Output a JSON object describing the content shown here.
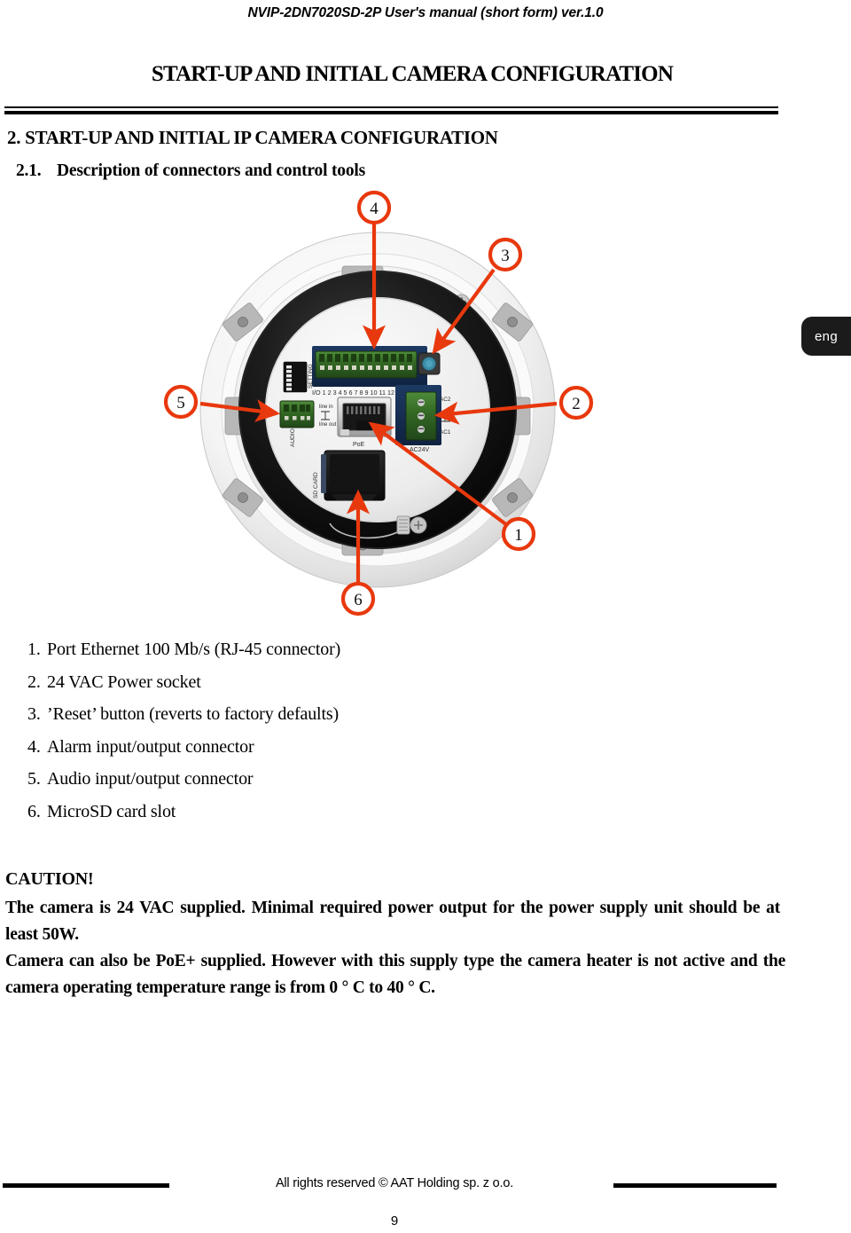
{
  "running_head": "NVIP-2DN7020SD-2P User's manual (short form) ver.1.0",
  "chapter_title": "START-UP AND INITIAL CAMERA CONFIGURATION",
  "headings": {
    "h2": "2. START-UP AND INITIAL IP CAMERA CONFIGURATION",
    "h3_number": "2.1.",
    "h3_text": "Description of connectors and control tools"
  },
  "language_tab": {
    "label": "eng"
  },
  "figure": {
    "alt": "Rear view of dome IP camera housing showing connector board with numbered callouts",
    "callouts": [
      {
        "id": "1",
        "label": "1"
      },
      {
        "id": "2",
        "label": "2"
      },
      {
        "id": "3",
        "label": "3"
      },
      {
        "id": "4",
        "label": "4"
      },
      {
        "id": "5",
        "label": "5"
      },
      {
        "id": "6",
        "label": "6"
      }
    ],
    "board_labels": {
      "setting": "SETTING",
      "io_pins": "I/O 1 2 3 4 5 6 7 8 9 10 11 12",
      "line_in": "line in",
      "line_out": "line out",
      "audio": "AUDIO",
      "poe": "PoE",
      "sd_card": "SD CARD",
      "ac2": "AC2",
      "ac1": "AC1",
      "ac24v": "AC24V"
    },
    "accent_color": "#e8380d"
  },
  "connector_list": [
    {
      "num": "1.",
      "text": "Port Ethernet 100 Mb/s (RJ-45 connector)"
    },
    {
      "num": "2.",
      "text": "24 VAC Power socket"
    },
    {
      "num": "3.",
      "text": "’Reset’ button (reverts to factory defaults)"
    },
    {
      "num": "4.",
      "text": "Alarm input/output  connector"
    },
    {
      "num": "5.",
      "text": "Audio input/output connector"
    },
    {
      "num": "6.",
      "text": "MicroSD card slot"
    }
  ],
  "caution": {
    "heading": "CAUTION!",
    "paragraph_1": "The camera is 24 VAC supplied. Minimal required power output for the power supply unit should be at least 50W.",
    "paragraph_2": "Camera can also be PoE+ supplied. However with this supply type the camera heater is not active and the camera operating temperature range is from 0 ° C to 40 ° C."
  },
  "footer": {
    "copyright": "All rights reserved © AAT Holding sp. z o.o.",
    "page_number": "9"
  }
}
